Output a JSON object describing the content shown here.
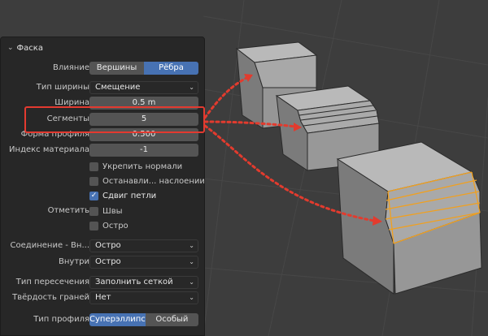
{
  "panel": {
    "title": "Фаска",
    "affect": {
      "label": "Влияние",
      "options": [
        "Вершины",
        "Рёбра"
      ],
      "active": 1
    },
    "width_type": {
      "label": "Тип ширины",
      "value": "Смещение"
    },
    "width": {
      "label": "Ширина",
      "value": "0.5 m"
    },
    "segments": {
      "label": "Сегменты",
      "value": "5"
    },
    "profile_shape": {
      "label": "Форма профиля",
      "value": "0.500"
    },
    "material_index": {
      "label": "Индекс материала",
      "value": "-1"
    },
    "harden_normals": {
      "label": "Укрепить нормали",
      "checked": false
    },
    "clamp_overlap": {
      "label": "Останавли... наслоении",
      "checked": false
    },
    "loop_slide": {
      "label": "Сдвиг петли",
      "checked": true
    },
    "mark": {
      "label": "Отметить"
    },
    "seams": {
      "label": "Швы",
      "checked": false
    },
    "sharp": {
      "label": "Остро",
      "checked": false
    },
    "miter_outer": {
      "label": "Соединение - Вн...",
      "value": "Остро"
    },
    "miter_inner": {
      "label": "Внутри",
      "value": "Остро"
    },
    "intersection": {
      "label": "Тип пересечения",
      "value": "Заполнить сеткой"
    },
    "face_strength": {
      "label": "Твёрдость граней",
      "value": "Нет"
    },
    "profile_type": {
      "label": "Тип профиля",
      "options": [
        "Суперэллипс",
        "Особый"
      ],
      "active": 0
    }
  },
  "colors": {
    "accent": "#4772b3",
    "highlight_box": "#e33a30",
    "arrow_dots": "#e23b2e",
    "bevel_edge": "#f0a020",
    "viewport_bg": "#3d3d3d"
  }
}
